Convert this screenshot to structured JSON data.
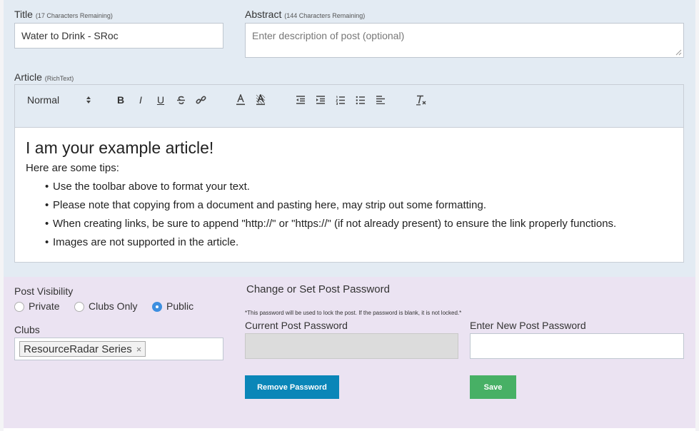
{
  "title_field": {
    "label": "Title",
    "hint": "(17 Characters Remaining)",
    "value": "Water to Drink - SRoc"
  },
  "abstract_field": {
    "label": "Abstract",
    "hint": "(144 Characters Remaining)",
    "placeholder": "Enter description of post (optional)"
  },
  "article": {
    "label": "Article",
    "hint": "(RichText)",
    "toolbar": {
      "format_select": "Normal",
      "bold": "B",
      "italic": "I",
      "underline": "U",
      "icons": [
        "strike-icon",
        "link-icon",
        "font-color-icon",
        "background-color-icon",
        "outdent-icon",
        "indent-icon",
        "ordered-list-icon",
        "bullet-list-icon",
        "align-icon",
        "clear-format-icon"
      ]
    },
    "heading": "I am your example article!",
    "intro": "Here are some tips:",
    "tips": [
      "Use the toolbar above to format your text.",
      "Please note that copying from a document and pasting here, may strip out some formatting.",
      "When creating links, be sure to append \"http://\" or \"https://\" (if not already present) to ensure the link properly functions.",
      "Images are not supported in the article."
    ]
  },
  "visibility": {
    "label": "Post Visibility",
    "options": [
      "Private",
      "Clubs Only",
      "Public"
    ],
    "selected": "Public"
  },
  "clubs": {
    "label": "Clubs",
    "selected": [
      "ResourceRadar Series"
    ],
    "remove_symbol": "×"
  },
  "password": {
    "heading": "Change or Set Post Password",
    "note": "*This password will be used to lock the post. If the password is blank, it is not locked.*",
    "current_label": "Current Post Password",
    "new_label": "Enter New Post Password",
    "remove_button": "Remove Password",
    "save_button": "Save"
  },
  "colors": {
    "top_background": "#e3ebf3",
    "bottom_background": "#ebe3f2",
    "radio_selected": "#3d8fe0",
    "remove_button": "#0a86b8",
    "save_button": "#47b065"
  }
}
